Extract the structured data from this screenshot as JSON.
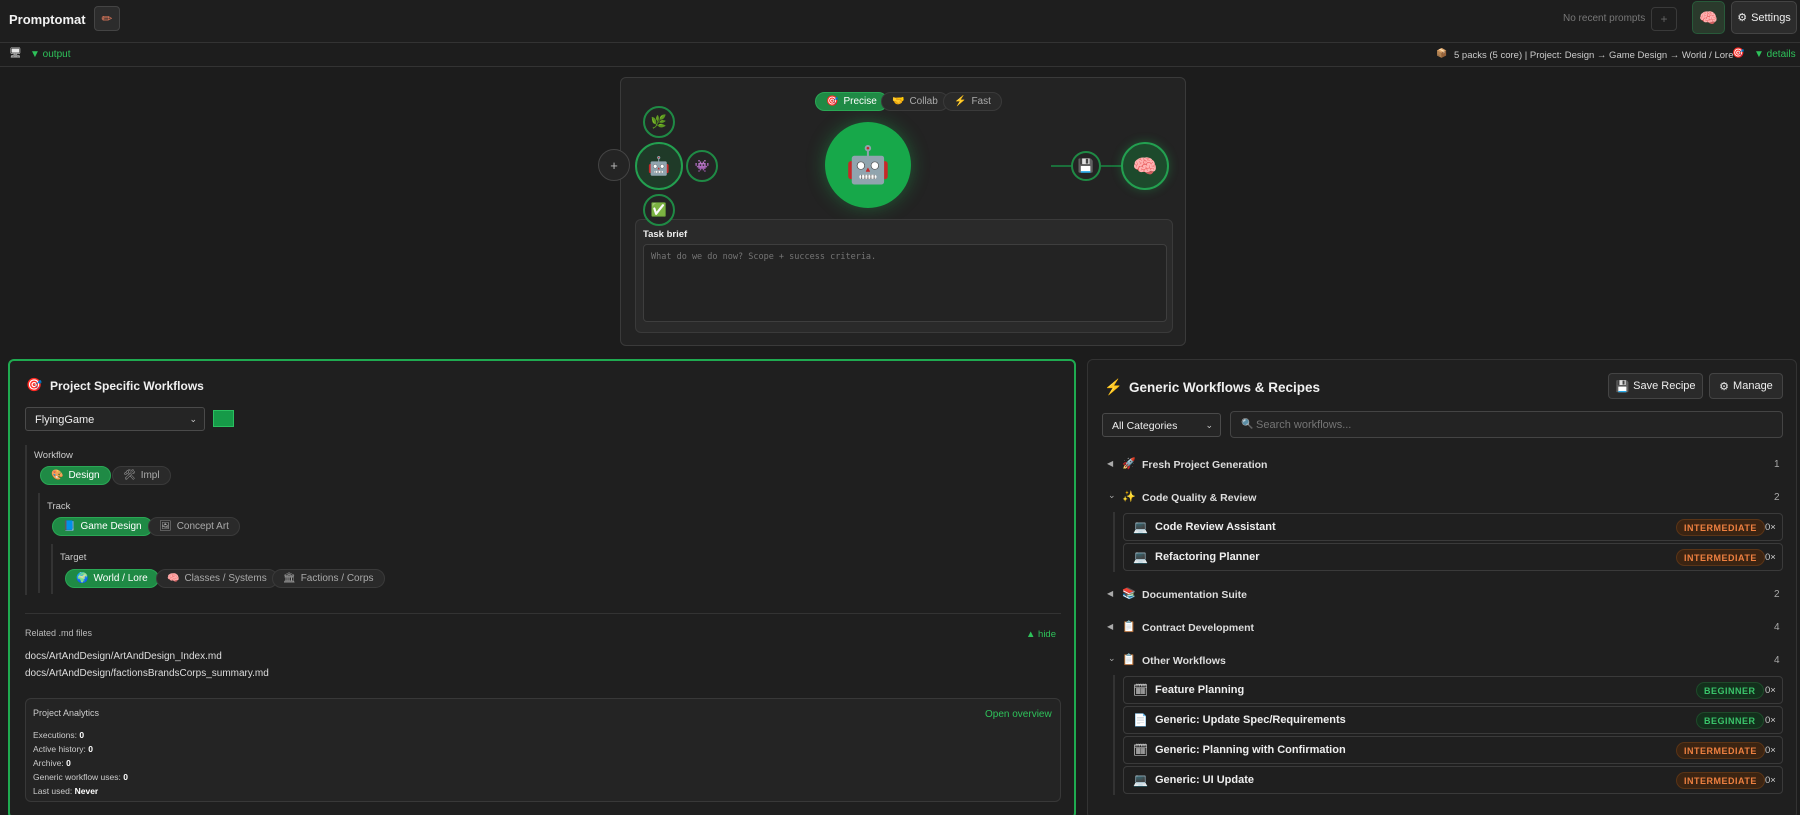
{
  "topbar": {
    "brand": "Promptomat",
    "recent": "No recent prompts",
    "plus": "+",
    "settings_label": "Settings"
  },
  "subbar": {
    "output_label": "▼ output",
    "status": "5 packs (5 core) | Project: Design → Game Design → World / Lore",
    "details_label": "▼ details"
  },
  "stage": {
    "modes": [
      {
        "label": "Precise",
        "icon": "🎯",
        "active": true
      },
      {
        "label": "Collab",
        "icon": "🤝",
        "active": false
      },
      {
        "label": "Fast",
        "icon": "⚡",
        "active": false
      }
    ],
    "plus": "+",
    "task_label": "Task brief",
    "task_placeholder": "What do we do now? Scope + success criteria."
  },
  "project": {
    "title": "Project Specific Workflows",
    "project_select": "FlyingGame",
    "accent_color": "#169a48",
    "workflow_label": "Workflow",
    "workflow_chips": [
      {
        "label": "Design",
        "active": true
      },
      {
        "label": "Impl",
        "active": false
      }
    ],
    "track_label": "Track",
    "track_chips": [
      {
        "label": "Game Design",
        "active": true
      },
      {
        "label": "Concept Art",
        "active": false
      }
    ],
    "target_label": "Target",
    "target_chips": [
      {
        "label": "World / Lore",
        "active": true
      },
      {
        "label": "Classes / Systems",
        "active": false
      },
      {
        "label": "Factions / Corps",
        "active": false
      }
    ],
    "related_label": "Related .md files",
    "hide_label": "▲ hide",
    "files": [
      "docs/ArtAndDesign/ArtAndDesign_Index.md",
      "docs/ArtAndDesign/factionsBrandsCorps_summary.md"
    ],
    "analytics": {
      "title": "Project Analytics",
      "open_label": "Open overview",
      "rows": [
        {
          "label": "Executions:",
          "value": "0"
        },
        {
          "label": "Active history:",
          "value": "0"
        },
        {
          "label": "Archive:",
          "value": "0"
        },
        {
          "label": "Generic workflow uses:",
          "value": "0"
        },
        {
          "label": "Last used:",
          "value": "Never"
        }
      ]
    }
  },
  "generic": {
    "title": "Generic Workflows & Recipes",
    "save_label": "Save Recipe",
    "manage_label": "Manage",
    "category_select": "All Categories",
    "search_placeholder": "Search workflows...",
    "categories": [
      {
        "name": "Fresh Project Generation",
        "icon": "🚀",
        "count": "1",
        "arrow": "◀"
      },
      {
        "name": "Code Quality & Review",
        "icon": "✨",
        "count": "2",
        "arrow": "⌄"
      },
      {
        "name": "Documentation Suite",
        "icon": "📚",
        "count": "2",
        "arrow": "◀"
      },
      {
        "name": "Contract Development",
        "icon": "📋",
        "count": "4",
        "arrow": "◀"
      },
      {
        "name": "Other Workflows",
        "icon": "📋",
        "count": "4",
        "arrow": "⌄"
      }
    ],
    "workflows": [
      {
        "name": "Code Review Assistant",
        "icon": "💻",
        "level": "INTERMEDIATE",
        "uses": "0×"
      },
      {
        "name": "Refactoring Planner",
        "icon": "💻",
        "level": "INTERMEDIATE",
        "uses": "0×"
      },
      {
        "name": "Feature Planning",
        "icon": "🗓",
        "level": "BEGINNER",
        "uses": "0×"
      },
      {
        "name": "Generic: Update Spec/Requirements",
        "icon": "📄",
        "level": "BEGINNER",
        "uses": "0×"
      },
      {
        "name": "Generic: Planning with Confirmation",
        "icon": "🗓",
        "level": "INTERMEDIATE",
        "uses": "0×"
      },
      {
        "name": "Generic: UI Update",
        "icon": "💻",
        "level": "INTERMEDIATE",
        "uses": "0×"
      }
    ]
  }
}
